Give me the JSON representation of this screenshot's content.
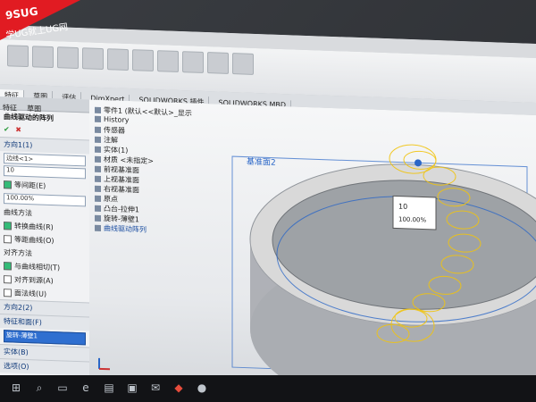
{
  "watermark": {
    "line1": "9SUG",
    "line2": "学UG就上UG网"
  },
  "menubar": {
    "items": [
      "",
      "",
      "",
      "",
      "",
      "",
      "",
      ""
    ]
  },
  "tabs": [
    {
      "label": "特征"
    },
    {
      "label": "草图"
    },
    {
      "label": "评估"
    },
    {
      "label": "DimXpert"
    },
    {
      "label": "SOLIDWORKS 插件"
    },
    {
      "label": "SOLIDWORKS MBD"
    }
  ],
  "left_panel": {
    "tabs": [
      "特征",
      "草图",
      "",
      "",
      ""
    ],
    "title": "曲线驱动的阵列",
    "section_direction1": "方向1(1)",
    "direction_field": "边线<1>",
    "count_field": "10",
    "equal_spacing_label": "等间距(E)",
    "spacing_field": "100.00%",
    "curve_method_label": "曲线方法",
    "transform_curve_label": "转换曲线(R)",
    "equidistant_curve_label": "等距曲线(O)",
    "alignment_label": "对齐方法",
    "tangent_label": "与曲线相切(T)",
    "align_source_label": "对齐到源(A)",
    "face_normal_label": "面法线(U)",
    "section_direction2": "方向2(2)",
    "section_features": "特征和面(F)",
    "selected_feature": "旋转-薄壁1",
    "section_bodies": "实体(B)",
    "section_options": "选项(O)"
  },
  "tree": {
    "nodes": [
      "零件1 (默认<<默认>_显示",
      "History",
      "传感器",
      "注解",
      "实体(1)",
      "材质 <未指定>",
      "前视基准面",
      "上视基准面",
      "右视基准面",
      "原点",
      "凸台-拉伸1",
      "旋转-薄壁1",
      "曲线驱动阵列"
    ]
  },
  "viewport": {
    "plane_label": "基准面2",
    "popup_label": "10",
    "popup_value": "100.00%"
  },
  "taskbar": {
    "items": [
      "start",
      "search",
      "taskview",
      "edge",
      "explorer",
      "store",
      "mail",
      "solidworks",
      "other"
    ]
  },
  "colors": {
    "accent": "#2a66c7",
    "selection": "#f1c40f",
    "ring_outer": "#d9d9d9",
    "ring_inner": "#9ea2a6"
  }
}
